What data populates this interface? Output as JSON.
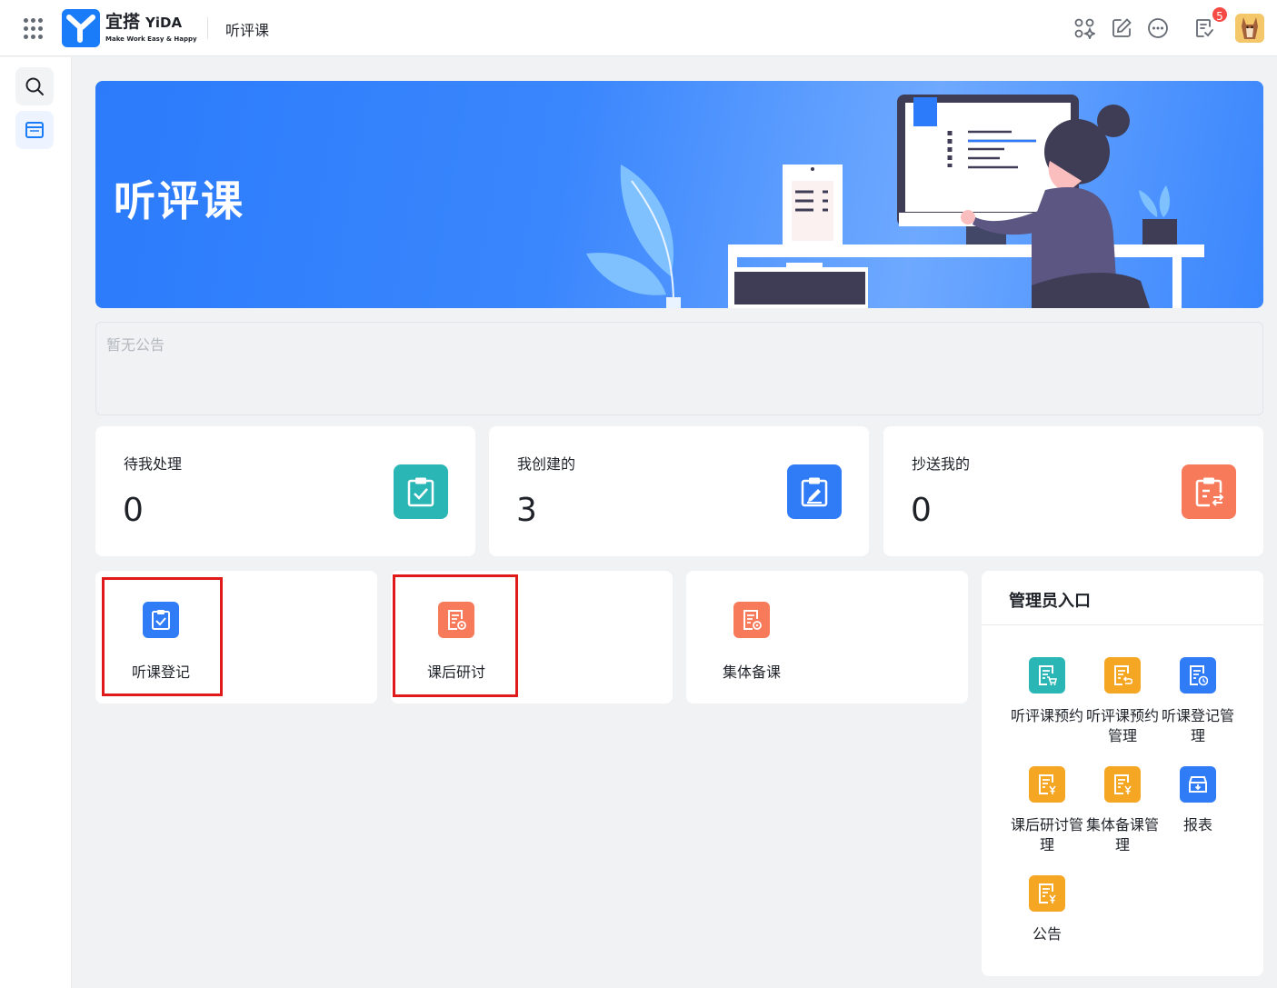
{
  "header": {
    "brand_cn": "宜搭",
    "brand_en": "YiDA",
    "brand_slogan": "Make Work Easy & Happy",
    "app_title": "听评课",
    "notification_count": "5",
    "icons": [
      "apps-grid-icon",
      "app-center-icon",
      "edit-icon",
      "more-icon",
      "todo-icon",
      "avatar"
    ]
  },
  "rail": {
    "items": [
      "search-icon",
      "page-icon"
    ]
  },
  "banner": {
    "title": "听评课"
  },
  "notice": {
    "text": "暂无公告"
  },
  "stats": [
    {
      "label": "待我处理",
      "value": "0",
      "icon": "clipboard-check-icon",
      "color": "#2ab6b4"
    },
    {
      "label": "我创建的",
      "value": "3",
      "icon": "clipboard-edit-icon",
      "color": "#2f7cf6"
    },
    {
      "label": "抄送我的",
      "value": "0",
      "icon": "clipboard-share-icon",
      "color": "#f77a5b"
    }
  ],
  "entries": [
    {
      "label": "听课登记",
      "icon": "clipboard-check-icon",
      "color": "#2f7cf6"
    },
    {
      "label": "课后研讨",
      "icon": "document-gear-icon",
      "color": "#f77a5b"
    },
    {
      "label": "集体备课",
      "icon": "document-gear-icon",
      "color": "#f77a5b"
    }
  ],
  "admin": {
    "title": "管理员入口",
    "items": [
      {
        "label": "听评课预约",
        "icon": "document-cart-icon",
        "color": "#2ab6b4"
      },
      {
        "label": "听评课预约管理",
        "icon": "document-return-icon",
        "color": "#f5a623"
      },
      {
        "label": "听课登记管理",
        "icon": "document-clock-icon",
        "color": "#2f7cf6"
      },
      {
        "label": "课后研讨管理",
        "icon": "document-yen-icon",
        "color": "#f5a623"
      },
      {
        "label": "集体备课管理",
        "icon": "document-yen-icon",
        "color": "#f5a623"
      },
      {
        "label": "报表",
        "icon": "archive-download-icon",
        "color": "#2f7cf6"
      },
      {
        "label": "公告",
        "icon": "document-yen-icon",
        "color": "#f5a623"
      }
    ]
  }
}
